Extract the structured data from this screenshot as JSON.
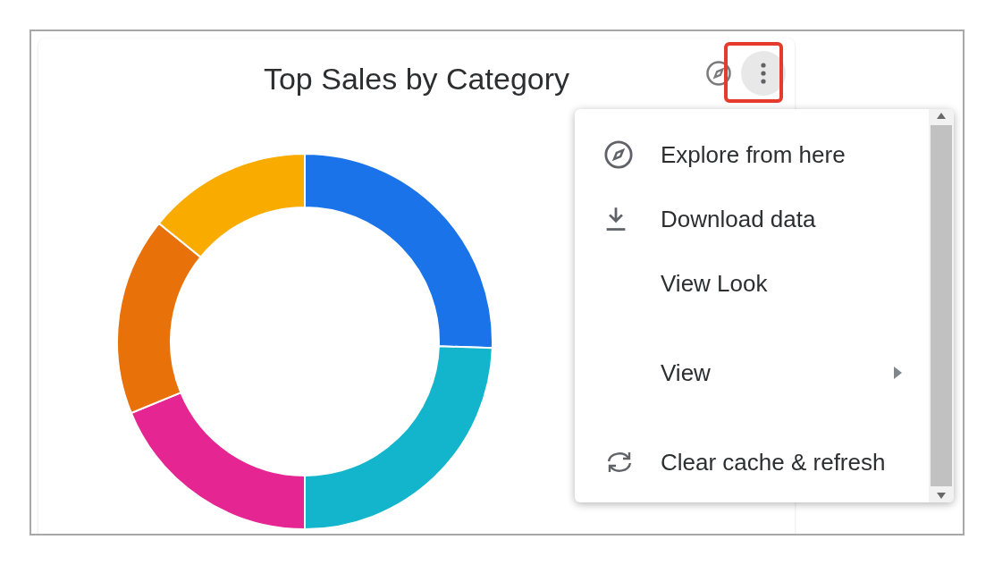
{
  "card": {
    "title": "Top Sales by Category"
  },
  "menu": {
    "groups": [
      [
        {
          "label": "Explore from here",
          "kind": "explore"
        },
        {
          "label": "Download data",
          "kind": "download"
        },
        {
          "label": "View Look",
          "kind": "plain"
        }
      ],
      [
        {
          "label": "View",
          "kind": "submenu"
        }
      ],
      [
        {
          "label": "Clear cache & refresh",
          "kind": "refresh"
        }
      ]
    ]
  }
}
